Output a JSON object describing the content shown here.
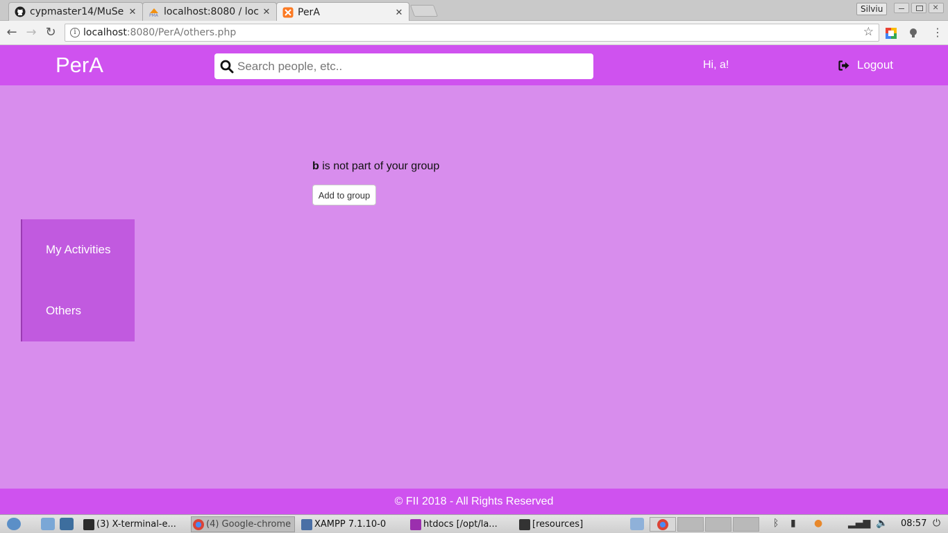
{
  "browser": {
    "tabs": [
      {
        "title": "cypmaster14/MuSe",
        "favicon": "github-icon"
      },
      {
        "title": "localhost:8080 / loc",
        "favicon": "phpmyadmin-icon"
      },
      {
        "title": "PerA",
        "favicon": "xampp-icon",
        "active": true
      }
    ],
    "profile_name": "Silviu",
    "url_host": "localhost",
    "url_rest": ":8080/PerA/others.php"
  },
  "header": {
    "brand": "PerA",
    "search_placeholder": "Search people, etc..",
    "greeting": "Hi, a!",
    "logout_label": "Logout",
    "color": "#cf52ef"
  },
  "main": {
    "username": "b",
    "message_rest": " is not part of your group",
    "add_button_label": "Add to group",
    "background": "#d88ded"
  },
  "sidebar": {
    "items": [
      {
        "label": "My Activities"
      },
      {
        "label": "Others"
      }
    ],
    "color": "#c15adf"
  },
  "footer": {
    "copyright_symbol": "©",
    "text": " FII 2018 - All Rights Reserved"
  },
  "taskbar": {
    "tasks": [
      {
        "label": "(3) X-terminal-e..."
      },
      {
        "label": "(4) Google-chrome",
        "active": true
      },
      {
        "label": "XAMPP 7.1.10-0"
      },
      {
        "label": "htdocs [/opt/la..."
      },
      {
        "label": "[resources]"
      }
    ],
    "clock": "08:57"
  }
}
